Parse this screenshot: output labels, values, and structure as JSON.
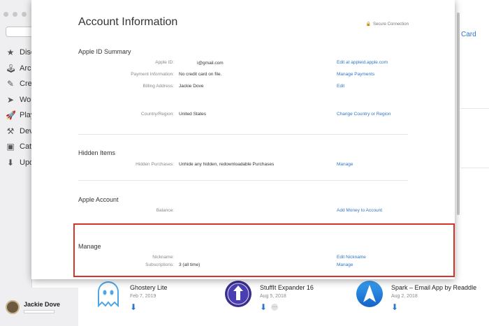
{
  "sidebar": {
    "search_glyph": "Q",
    "items": [
      {
        "icon": "star-icon",
        "label": "Disc"
      },
      {
        "icon": "arcade-icon",
        "label": "Arca"
      },
      {
        "icon": "brush-icon",
        "label": "Crea"
      },
      {
        "icon": "paper-plane-icon",
        "label": "Wor"
      },
      {
        "icon": "rocket-icon",
        "label": "Play"
      },
      {
        "icon": "hammer-icon",
        "label": "Dev"
      },
      {
        "icon": "categories-icon",
        "label": "Cate"
      },
      {
        "icon": "updates-icon",
        "label": "Upd"
      }
    ],
    "user_name": "Jackie Dove"
  },
  "background": {
    "card_link": "Card",
    "apps": [
      {
        "name": "Ghostery Lite",
        "date": "Feb 7, 2019",
        "icon": "ghost-icon"
      },
      {
        "name": "StuffIt Expander 16",
        "date": "Aug 5, 2018",
        "icon": "stuffit-icon",
        "more": "…"
      },
      {
        "name": "Spark – Email App by Readdle",
        "date": "Aug 2, 2018",
        "icon": "spark-icon"
      }
    ]
  },
  "sheet": {
    "title": "Account Information",
    "secure_label": "Secure Connection",
    "sections": {
      "summary": {
        "title": "Apple ID Summary",
        "apple_id_label": "Apple ID:",
        "apple_id_value": "i@gmail.com",
        "apple_id_link": "Edit at appleid.apple.com",
        "payment_label": "Payment Information:",
        "payment_value": "No credit card on file.",
        "payment_link": "Manage Payments",
        "billing_label": "Billing Address:",
        "billing_value": "Jackie Dove",
        "billing_link": "Edit",
        "country_label": "Country/Region:",
        "country_value": "United States",
        "country_link": "Change Country or Region"
      },
      "hidden": {
        "title": "Hidden Items",
        "label": "Hidden Purchases:",
        "value": "Unhide any hidden, redownloadable Purchases",
        "link": "Manage"
      },
      "account": {
        "title": "Apple Account",
        "label": "Balance:",
        "link": "Add Money to Account"
      },
      "manage": {
        "title": "Manage",
        "nickname_label": "Nickname:",
        "nickname_link": "Edit Nickname",
        "subs_label": "Subscriptions:",
        "subs_value": "3 (all time)",
        "subs_link": "Manage"
      }
    }
  },
  "colors": {
    "link": "#2f76c8",
    "highlight": "#d8332a"
  }
}
